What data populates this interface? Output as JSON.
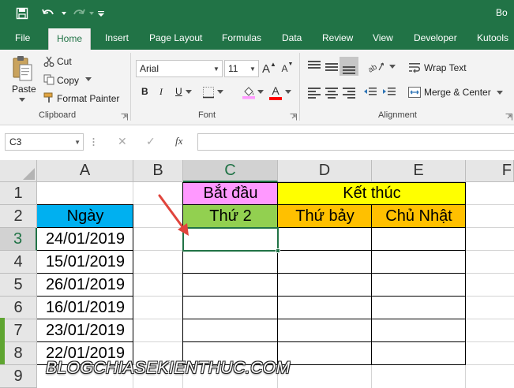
{
  "titlebar": {
    "document_title": "Bo"
  },
  "ribbon_tabs": [
    {
      "label": "File",
      "active": false
    },
    {
      "label": "Home",
      "active": true
    },
    {
      "label": "Insert",
      "active": false
    },
    {
      "label": "Page Layout",
      "active": false
    },
    {
      "label": "Formulas",
      "active": false
    },
    {
      "label": "Data",
      "active": false
    },
    {
      "label": "Review",
      "active": false
    },
    {
      "label": "View",
      "active": false
    },
    {
      "label": "Developer",
      "active": false
    },
    {
      "label": "Kutools",
      "active": false
    }
  ],
  "clipboard": {
    "paste_label": "Paste",
    "cut_label": "Cut",
    "copy_label": "Copy",
    "format_painter_label": "Format Painter",
    "group_label": "Clipboard"
  },
  "font": {
    "font_name": "Arial",
    "font_size": "11",
    "bold": "B",
    "italic": "I",
    "underline": "U",
    "grow": "A",
    "shrink": "A",
    "font_color_glyph": "A",
    "group_label": "Font"
  },
  "alignment": {
    "wrap_text_label": "Wrap Text",
    "merge_center_label": "Merge & Center",
    "group_label": "Alignment"
  },
  "formula_bar": {
    "name_box": "C3",
    "cancel_glyph": "✕",
    "enter_glyph": "✓",
    "fx_label": "fx",
    "formula": ""
  },
  "sheet": {
    "columns": [
      "A",
      "B",
      "C",
      "D",
      "E",
      "F"
    ],
    "rows": [
      "1",
      "2",
      "3",
      "4",
      "5",
      "6",
      "7",
      "8",
      "9"
    ],
    "selected_cell": "C3",
    "cells": {
      "C1": "Bắt đầu",
      "D1": "Kết thúc",
      "A2": "Ngày",
      "C2": "Thứ 2",
      "D2": "Thứ bảy",
      "E2": "Chủ Nhật",
      "A3": "24/01/2019",
      "A4": "15/01/2019",
      "A5": "26/01/2019",
      "A6": "16/01/2019",
      "A7": "23/01/2019",
      "A8": "22/01/2019"
    },
    "fill_colors": {
      "header_blue": "#00b0f0",
      "start_pink": "#ff99ff",
      "end_yellow": "#ffff00",
      "monday_green": "#92d050",
      "weekend_orange": "#ffc000"
    }
  },
  "watermark": "BLOGCHIASEKIENTHUC.COM",
  "colors": {
    "excel_green": "#217346",
    "annotation_arrow": "#e0443c"
  }
}
